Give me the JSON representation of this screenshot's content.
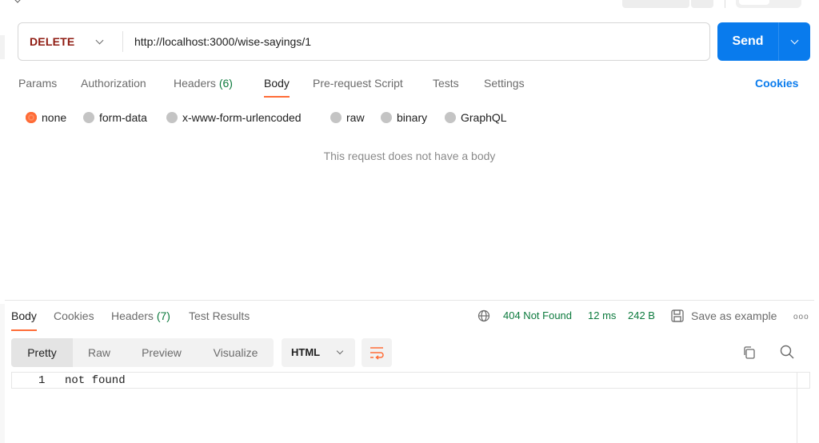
{
  "request": {
    "method": "DELETE",
    "url": "http://localhost:3000/wise-sayings/1",
    "send_label": "Send"
  },
  "request_tabs": [
    {
      "label": "Params"
    },
    {
      "label": "Authorization"
    },
    {
      "label": "Headers",
      "count": "(6)"
    },
    {
      "label": "Body"
    },
    {
      "label": "Pre-request Script"
    },
    {
      "label": "Tests"
    },
    {
      "label": "Settings"
    }
  ],
  "cookies_link": "Cookies",
  "body_types": [
    {
      "label": "none",
      "selected": true
    },
    {
      "label": "form-data"
    },
    {
      "label": "x-www-form-urlencoded"
    },
    {
      "label": "raw"
    },
    {
      "label": "binary"
    },
    {
      "label": "GraphQL"
    }
  ],
  "no_body_message": "This request does not have a body",
  "response_tabs": [
    {
      "label": "Body"
    },
    {
      "label": "Cookies"
    },
    {
      "label": "Headers",
      "count": "(7)"
    },
    {
      "label": "Test Results"
    }
  ],
  "response_status": {
    "code": "404 Not Found",
    "time": "12 ms",
    "size": "242 B",
    "save_label": "Save as example",
    "more": "ooo"
  },
  "view_modes": [
    {
      "label": "Pretty"
    },
    {
      "label": "Raw"
    },
    {
      "label": "Preview"
    },
    {
      "label": "Visualize"
    }
  ],
  "format": "HTML",
  "response_body": [
    {
      "line": "1",
      "text": "not found"
    }
  ],
  "colors": {
    "accent": "#ff6c37",
    "send": "#097bed",
    "method": "#8e1a10",
    "status_ok_green": "#0c7a3d"
  }
}
